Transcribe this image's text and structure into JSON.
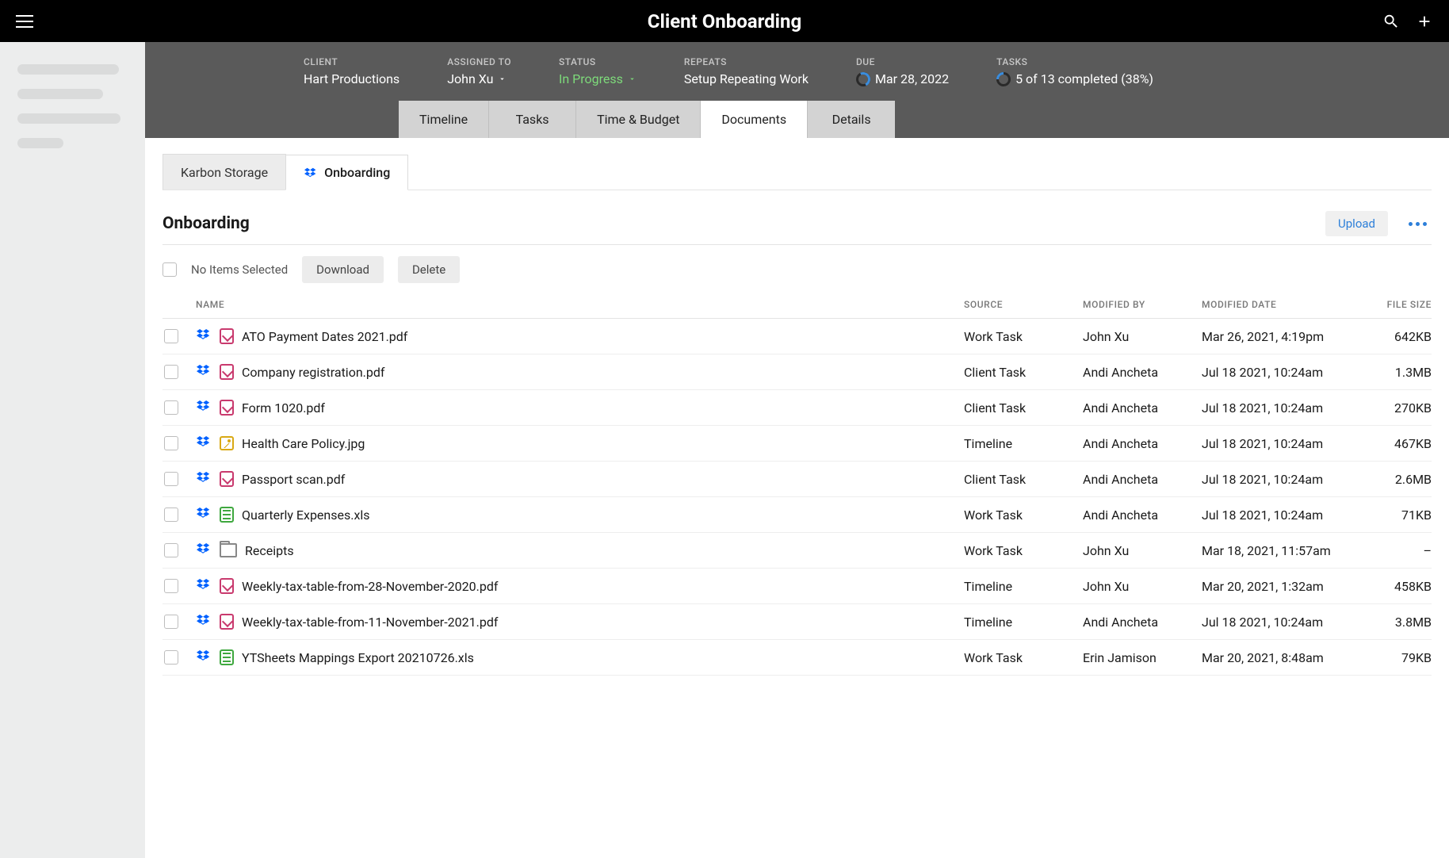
{
  "header": {
    "title": "Client Onboarding"
  },
  "meta": {
    "client_label": "CLIENT",
    "client_value": "Hart Productions",
    "assigned_label": "ASSIGNED TO",
    "assigned_value": "John Xu",
    "status_label": "STATUS",
    "status_value": "In Progress",
    "repeats_label": "REPEATS",
    "repeats_value": "Setup Repeating Work",
    "due_label": "DUE",
    "due_value": "Mar 28, 2022",
    "tasks_label": "TASKS",
    "tasks_value": "5 of 13  completed (38%)"
  },
  "tabs": {
    "timeline": "Timeline",
    "tasks": "Tasks",
    "timebudget": "Time & Budget",
    "documents": "Documents",
    "details": "Details"
  },
  "subtabs": {
    "karbon": "Karbon Storage",
    "onboarding": "Onboarding"
  },
  "section": {
    "title": "Onboarding",
    "upload": "Upload",
    "no_items": "No Items Selected",
    "download": "Download",
    "delete": "Delete"
  },
  "columns": {
    "name": "NAME",
    "source": "SOURCE",
    "modified_by": "MODIFIED BY",
    "modified_date": "MODIFIED DATE",
    "file_size": "FILE SIZE"
  },
  "rows": [
    {
      "name": "ATO Payment Dates 2021.pdf",
      "source": "Work Task",
      "modified_by": "John Xu",
      "modified_date": "Mar 26, 2021, 4:19pm",
      "size": "642KB",
      "type": "pdf"
    },
    {
      "name": "Company registration.pdf",
      "source": "Client Task",
      "modified_by": "Andi Ancheta",
      "modified_date": "Jul 18 2021, 10:24am",
      "size": "1.3MB",
      "type": "pdf"
    },
    {
      "name": "Form 1020.pdf",
      "source": "Client Task",
      "modified_by": "Andi Ancheta",
      "modified_date": "Jul 18 2021, 10:24am",
      "size": "270KB",
      "type": "pdf"
    },
    {
      "name": "Health Care Policy.jpg",
      "source": "Timeline",
      "modified_by": "Andi Ancheta",
      "modified_date": "Jul 18 2021, 10:24am",
      "size": "467KB",
      "type": "img"
    },
    {
      "name": "Passport scan.pdf",
      "source": "Client Task",
      "modified_by": "Andi Ancheta",
      "modified_date": "Jul 18 2021, 10:24am",
      "size": "2.6MB",
      "type": "pdf"
    },
    {
      "name": "Quarterly Expenses.xls",
      "source": "Work Task",
      "modified_by": "Andi Ancheta",
      "modified_date": "Jul 18 2021, 10:24am",
      "size": "71KB",
      "type": "xls"
    },
    {
      "name": "Receipts",
      "source": "Work Task",
      "modified_by": "John Xu",
      "modified_date": "Mar 18, 2021, 11:57am",
      "size": "–",
      "type": "folder"
    },
    {
      "name": "Weekly-tax-table-from-28-November-2020.pdf",
      "source": "Timeline",
      "modified_by": "John Xu",
      "modified_date": "Mar 20, 2021, 1:32am",
      "size": "458KB",
      "type": "pdf"
    },
    {
      "name": "Weekly-tax-table-from-11-November-2021.pdf",
      "source": "Timeline",
      "modified_by": "Andi Ancheta",
      "modified_date": "Jul 18 2021, 10:24am",
      "size": "3.8MB",
      "type": "pdf"
    },
    {
      "name": "YTSheets Mappings Export 20210726.xls",
      "source": "Work Task",
      "modified_by": "Erin Jamison",
      "modified_date": "Mar 20, 2021, 8:48am",
      "size": "79KB",
      "type": "xls"
    }
  ]
}
